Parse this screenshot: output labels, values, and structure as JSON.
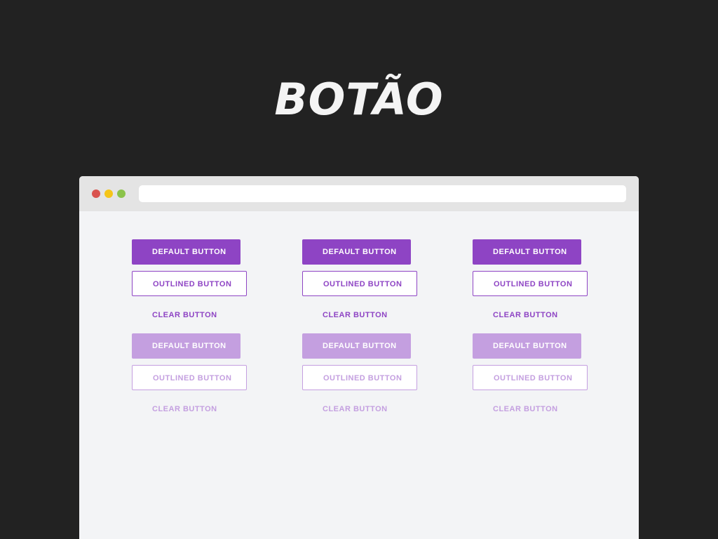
{
  "hero": {
    "title": "BOTÃO"
  },
  "colors": {
    "primary": "#8e44c4",
    "primary_disabled": "#c49fe0",
    "page_background": "#222222",
    "window_background": "#f3f4f6",
    "titlebar_background": "#e4e4e4",
    "dot_red": "#d9534f",
    "dot_yellow": "#f5c518",
    "dot_green": "#8bc34a"
  },
  "browser": {
    "window_controls": [
      "close-dot",
      "minimize-dot",
      "maximize-dot"
    ],
    "address_value": ""
  },
  "button_labels": {
    "default": "DEFAULT BUTTON",
    "outlined": "OUTLINED BUTTON",
    "clear": "CLEAR BUTTON"
  },
  "groups": [
    {
      "state": "enabled"
    },
    {
      "state": "disabled"
    }
  ],
  "columns": 3
}
